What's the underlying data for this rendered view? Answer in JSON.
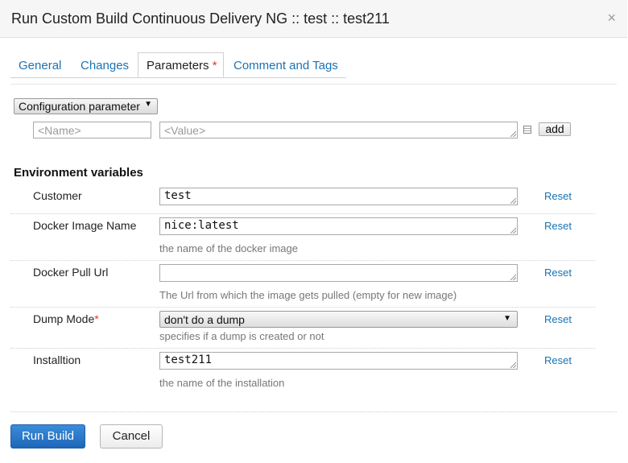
{
  "dialog": {
    "title": "Run Custom Build Continuous Delivery NG :: test :: test211",
    "close_glyph": "×"
  },
  "tabs": [
    {
      "label": "General"
    },
    {
      "label": "Changes"
    },
    {
      "label": "Parameters",
      "required_mark": "*",
      "active": true
    },
    {
      "label": "Comment and Tags"
    }
  ],
  "config": {
    "type_select": "Configuration parameter",
    "name_placeholder": "<Name>",
    "value_placeholder": "<Value>",
    "add_label": "add"
  },
  "env": {
    "heading": "Environment variables",
    "rows": [
      {
        "label": "Customer",
        "value": "test",
        "description": "",
        "reset": "Reset"
      },
      {
        "label": "Docker Image Name",
        "value": "nice:latest",
        "description": "the name of the docker image",
        "reset": "Reset"
      },
      {
        "label": "Docker Pull Url",
        "value": "",
        "description": "The Url from which the image gets pulled (empty for new image)",
        "reset": "Reset"
      },
      {
        "label": "Dump Mode",
        "required_mark": "*",
        "value": "don't do a dump",
        "description": "specifies if a dump is created or not",
        "reset": "Reset"
      },
      {
        "label": "Installtion",
        "value": "test211",
        "description": "the name of the installation",
        "reset": "Reset"
      }
    ]
  },
  "footer": {
    "run_label": "Run Build",
    "cancel_label": "Cancel"
  },
  "colors": {
    "link": "#1a73b5",
    "required": "#e03a1e",
    "primary_button": "#2a79c9"
  },
  "icons": {
    "close": "close-icon",
    "dropdown": "chevron-down-icon",
    "textarea_resize": "resize-grip-icon",
    "value_editor": "list-editor-icon"
  }
}
